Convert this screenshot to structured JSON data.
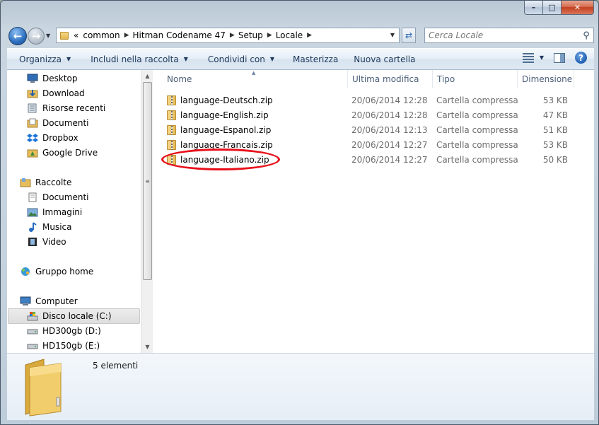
{
  "window": {
    "caption_buttons": {
      "minimize": "–",
      "maximize": "□",
      "close": "✕"
    }
  },
  "address": {
    "overflow": "«",
    "breadcrumbs": [
      "common",
      "Hitman Codename 47",
      "Setup",
      "Locale"
    ]
  },
  "search": {
    "placeholder": "Cerca Locale"
  },
  "toolbar": {
    "organize": "Organizza",
    "include": "Includi nella raccolta",
    "share": "Condividi con",
    "burn": "Masterizza",
    "new_folder": "Nuova cartella",
    "help": "?"
  },
  "sidebar": {
    "favorites": [
      {
        "label": "Desktop",
        "icon": "desktop-icon"
      },
      {
        "label": "Download",
        "icon": "download-folder-icon"
      },
      {
        "label": "Risorse recenti",
        "icon": "recent-places-icon"
      },
      {
        "label": "Documenti",
        "icon": "documents-folder-icon"
      },
      {
        "label": "Dropbox",
        "icon": "dropbox-icon"
      },
      {
        "label": "Google Drive",
        "icon": "google-drive-icon"
      }
    ],
    "libraries": {
      "label": "Raccolte",
      "items": [
        {
          "label": "Documenti",
          "icon": "documents-icon"
        },
        {
          "label": "Immagini",
          "icon": "pictures-icon"
        },
        {
          "label": "Musica",
          "icon": "music-icon"
        },
        {
          "label": "Video",
          "icon": "video-icon"
        }
      ]
    },
    "homegroup": {
      "label": "Gruppo home"
    },
    "computer": {
      "label": "Computer",
      "items": [
        {
          "label": "Disco locale (C:)",
          "selected": true
        },
        {
          "label": "HD300gb (D:)"
        },
        {
          "label": "HD150gb (E:)"
        }
      ]
    }
  },
  "file_list": {
    "columns": {
      "name": "Nome",
      "modified": "Ultima modifica",
      "type": "Tipo",
      "size": "Dimensione"
    },
    "files": [
      {
        "name": "language-Deutsch.zip",
        "modified": "20/06/2014 12:28",
        "type": "Cartella compressa",
        "size": "53 KB"
      },
      {
        "name": "language-English.zip",
        "modified": "20/06/2014 12:28",
        "type": "Cartella compressa",
        "size": "47 KB"
      },
      {
        "name": "language-Espanol.zip",
        "modified": "20/06/2014 12:13",
        "type": "Cartella compressa",
        "size": "51 KB"
      },
      {
        "name": "language-Francais.zip",
        "modified": "20/06/2014 12:27",
        "type": "Cartella compressa",
        "size": "53 KB"
      },
      {
        "name": "language-Italiano.zip",
        "modified": "20/06/2014 12:27",
        "type": "Cartella compressa",
        "size": "50 KB",
        "annotated": true
      }
    ],
    "annotation_color": "#e8101a"
  },
  "details": {
    "count_text": "5 elementi"
  }
}
